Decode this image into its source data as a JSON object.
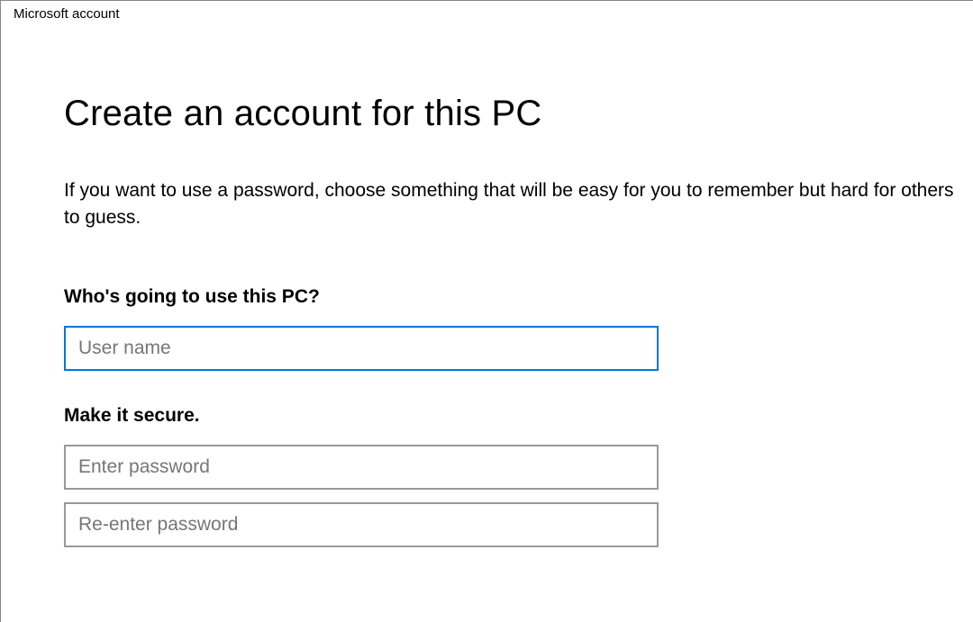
{
  "window": {
    "title": "Microsoft account"
  },
  "page": {
    "heading": "Create an account for this PC",
    "description": "If you want to use a password, choose something that will be easy for you to remember but hard for others to guess."
  },
  "sections": {
    "user": {
      "label": "Who's going to use this PC?",
      "username_placeholder": "User name",
      "username_value": ""
    },
    "secure": {
      "label": "Make it secure.",
      "password_placeholder": "Enter password",
      "password_value": "",
      "confirm_placeholder": "Re-enter password",
      "confirm_value": ""
    }
  }
}
